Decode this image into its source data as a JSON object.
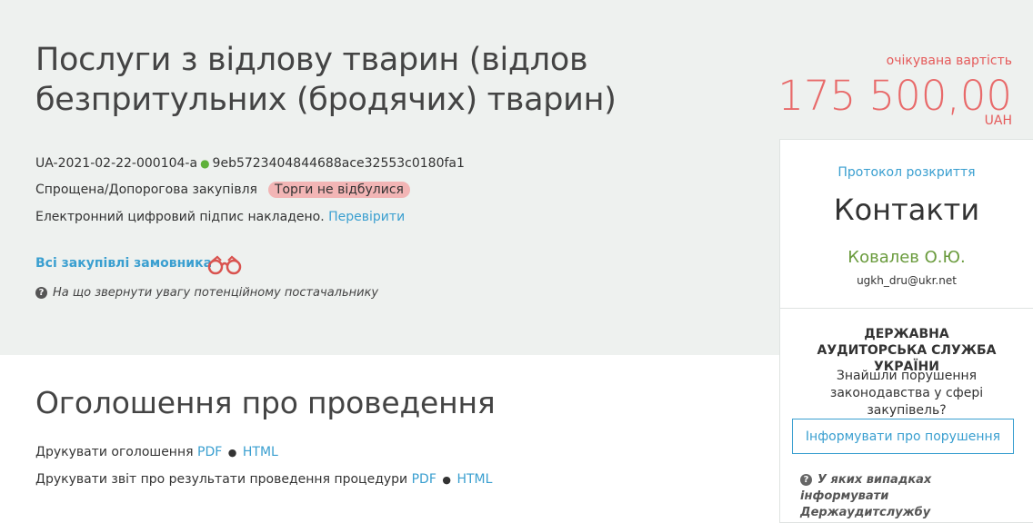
{
  "tender": {
    "title": "Послуги з відлову тварин (відлов безпритульних (бродячих) тварин)",
    "id": "UA-2021-02-22-000104-a",
    "hash": "9eb5723404844688ace32553c0180fa1",
    "procedure_type": "Спрощена/Допорогова закупівля",
    "status": "Торги не відбулися",
    "signature_text": "Електронний цифровий підпис накладено.",
    "signature_link": "Перевірити",
    "all_purchases_link": "Всі закупівлі замовника",
    "supplier_hint": "На що звернути увагу потенційному постачальнику"
  },
  "price": {
    "label": "очікувана вартість",
    "value": "175 500,00",
    "currency": "UAH"
  },
  "announcement": {
    "title": "Оголошення про проведення",
    "print_notice_label": "Друкувати оголошення",
    "print_report_label": "Друкувати звіт про результати проведення процедури",
    "pdf": "PDF",
    "html": "HTML"
  },
  "sidebar": {
    "protocol_link": "Протокол розкриття",
    "contacts_title": "Контакти",
    "contact_name": "Ковалев О.Ю.",
    "contact_email": "ugkh_dru@ukr.net",
    "audit_title": "ДЕРЖАВНА АУДИТОРСЬКА СЛУЖБА УКРАЇНИ",
    "audit_text": "Знайшли порушення законодавства у сфері закупівель?",
    "audit_button": "Інформувати про порушення",
    "audit_hint": "У яких випадках інформувати Держаудитслужбу"
  },
  "colors": {
    "accent": "#3a9fd0",
    "price": "#e86a6a",
    "status_badge": "#f2b5b5",
    "contact_name": "#6a9b3d",
    "header_bg": "#eef1ef"
  },
  "icons": [
    "binoculars-icon",
    "question-icon",
    "dot-icon"
  ]
}
